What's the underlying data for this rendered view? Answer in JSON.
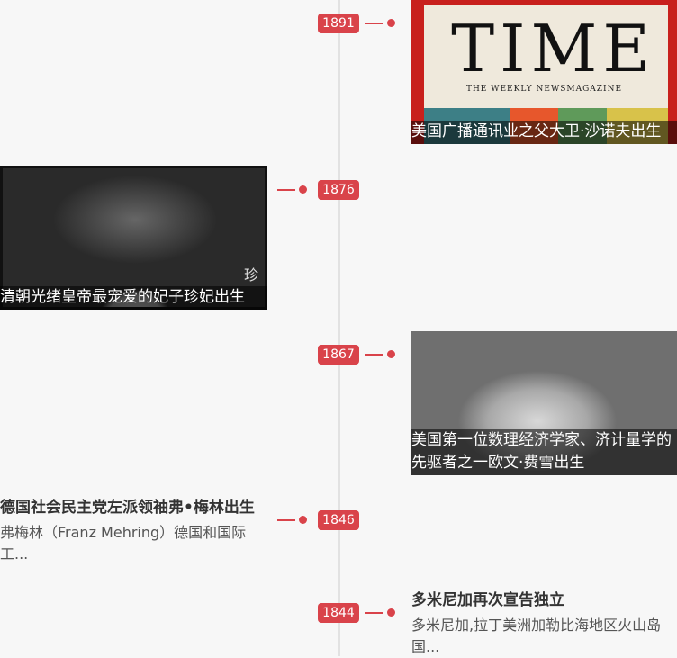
{
  "timeline": {
    "entries": [
      {
        "year": "1891",
        "caption": "美国广播通讯业之父大卫·沙诺夫出生",
        "image": {
          "logo_text": "TIME",
          "subtitle_text": "THE WEEKLY NEWSMAGAZINE"
        }
      },
      {
        "year": "1876",
        "caption": "清朝光绪皇帝最宠爱的妃子珍妃出生",
        "image": {
          "watermark_text": "珍"
        }
      },
      {
        "year": "1867",
        "caption": "美国第一位数理经济学家、济计量学的先驱者之一欧文·费雪出生"
      },
      {
        "year": "1846",
        "title": "德国社会民主党左派领袖弗•梅林出生",
        "description": "弗梅林（Franz Mehring）德国和国际工..."
      },
      {
        "year": "1844",
        "title": "多米尼加再次宣告独立",
        "description": "多米尼加,拉丁美洲加勒比海地区火山岛国..."
      }
    ]
  },
  "colors": {
    "accent": "#d9434a",
    "axis": "#e2e2e2",
    "background": "#f7f7f7"
  }
}
